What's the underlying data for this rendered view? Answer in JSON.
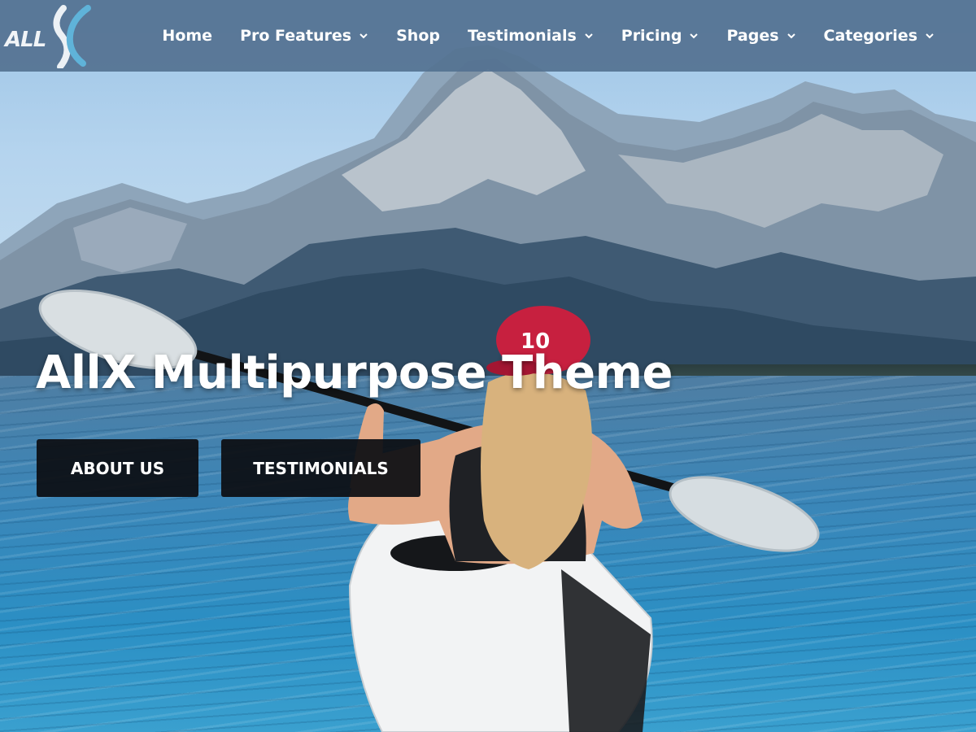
{
  "brand": {
    "logo_text": "ALL"
  },
  "nav": {
    "items": [
      {
        "label": "Home",
        "has_dropdown": false
      },
      {
        "label": "Pro Features",
        "has_dropdown": true
      },
      {
        "label": "Shop",
        "has_dropdown": false
      },
      {
        "label": "Testimonials",
        "has_dropdown": true
      },
      {
        "label": "Pricing",
        "has_dropdown": true
      },
      {
        "label": "Pages",
        "has_dropdown": true
      },
      {
        "label": "Categories",
        "has_dropdown": true
      }
    ]
  },
  "hero": {
    "title": "AllX Multipurpose Theme",
    "buttons": [
      {
        "label": "ABOUT US"
      },
      {
        "label": "TESTIMONIALS"
      }
    ]
  },
  "colors": {
    "nav_bg": "#547291",
    "button_bg": "#0c0e12",
    "logo_accent": "#5fb3d9"
  }
}
